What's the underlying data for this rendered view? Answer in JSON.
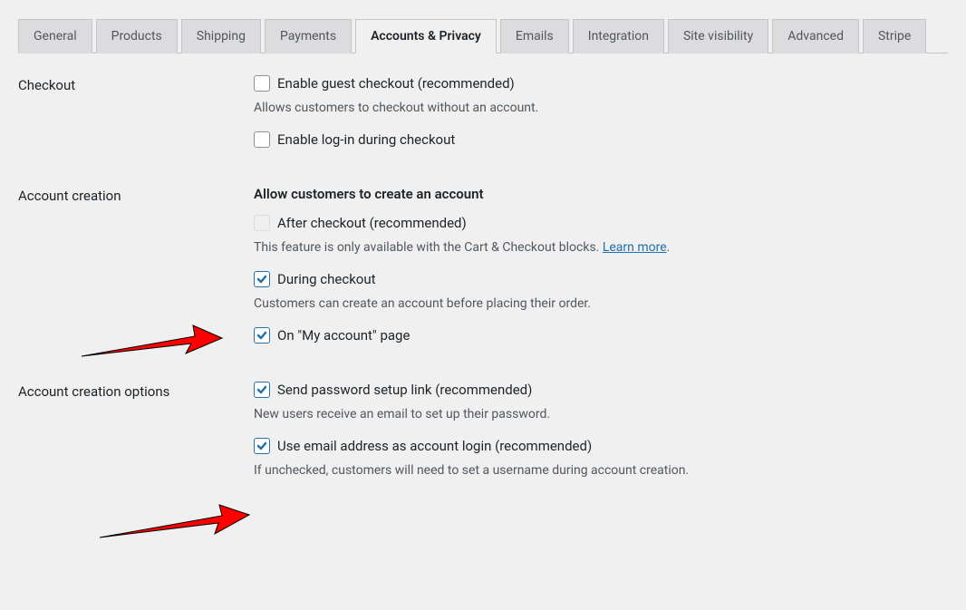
{
  "tabs": {
    "general": "General",
    "products": "Products",
    "shipping": "Shipping",
    "payments": "Payments",
    "accounts_privacy": "Accounts & Privacy",
    "emails": "Emails",
    "integration": "Integration",
    "site_visibility": "Site visibility",
    "advanced": "Advanced",
    "stripe": "Stripe"
  },
  "checkout": {
    "label": "Checkout",
    "guest_checkbox": "Enable guest checkout (recommended)",
    "guest_desc": "Allows customers to checkout without an account.",
    "login_checkbox": "Enable log-in during checkout"
  },
  "account_creation": {
    "label": "Account creation",
    "subheading": "Allow customers to create an account",
    "after_checkout": "After checkout (recommended)",
    "after_desc_prefix": "This feature is only available with the Cart & Checkout blocks. ",
    "learn_more": "Learn more",
    "after_desc_suffix": ".",
    "during_checkout": "During checkout",
    "during_desc": "Customers can create an account before placing their order.",
    "on_my_account": "On \"My account\" page"
  },
  "account_options": {
    "label": "Account creation options",
    "password_link": "Send password setup link (recommended)",
    "password_desc": "New users receive an email to set up their password.",
    "email_login": "Use email address as account login (recommended)",
    "email_desc": "If unchecked, customers will need to set a username during account creation."
  }
}
